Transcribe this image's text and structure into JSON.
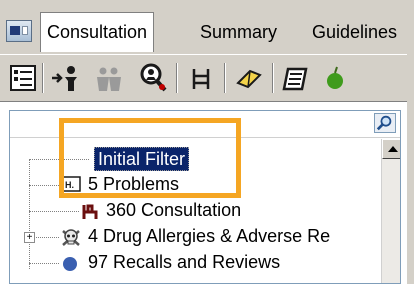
{
  "tabs": [
    {
      "label": "Consultation"
    },
    {
      "label": "Summary"
    },
    {
      "label": "Guidelines"
    }
  ],
  "toolbar": {
    "buttons": [
      {
        "icon": "clipboard-list-icon"
      },
      {
        "icon": "person-arrow-icon"
      },
      {
        "icon": "people-group-icon"
      },
      {
        "icon": "magnifier-person-icon"
      },
      {
        "icon": "ladder-icon"
      },
      {
        "icon": "eraser-icon"
      },
      {
        "icon": "notebook-icon"
      },
      {
        "icon": "apple-icon"
      }
    ]
  },
  "tree": {
    "search_icon": "search-icon",
    "nodes": [
      {
        "label": "Initial Filter",
        "selected": true
      },
      {
        "label": "5 Problems",
        "icon": "problems-icon"
      },
      {
        "label": "360 Consultation",
        "icon": "consultation-chair-icon"
      },
      {
        "label": "4 Drug Allergies & Adverse Re",
        "icon": "skull-crossbones-icon",
        "expandable": true
      },
      {
        "label": "97 Recalls and Reviews",
        "icon": "recall-icon"
      }
    ]
  },
  "colors": {
    "chrome": "#d4d0c8",
    "selection": "#0a246a",
    "highlight": "#f5a623",
    "border": "#7f9db9"
  }
}
